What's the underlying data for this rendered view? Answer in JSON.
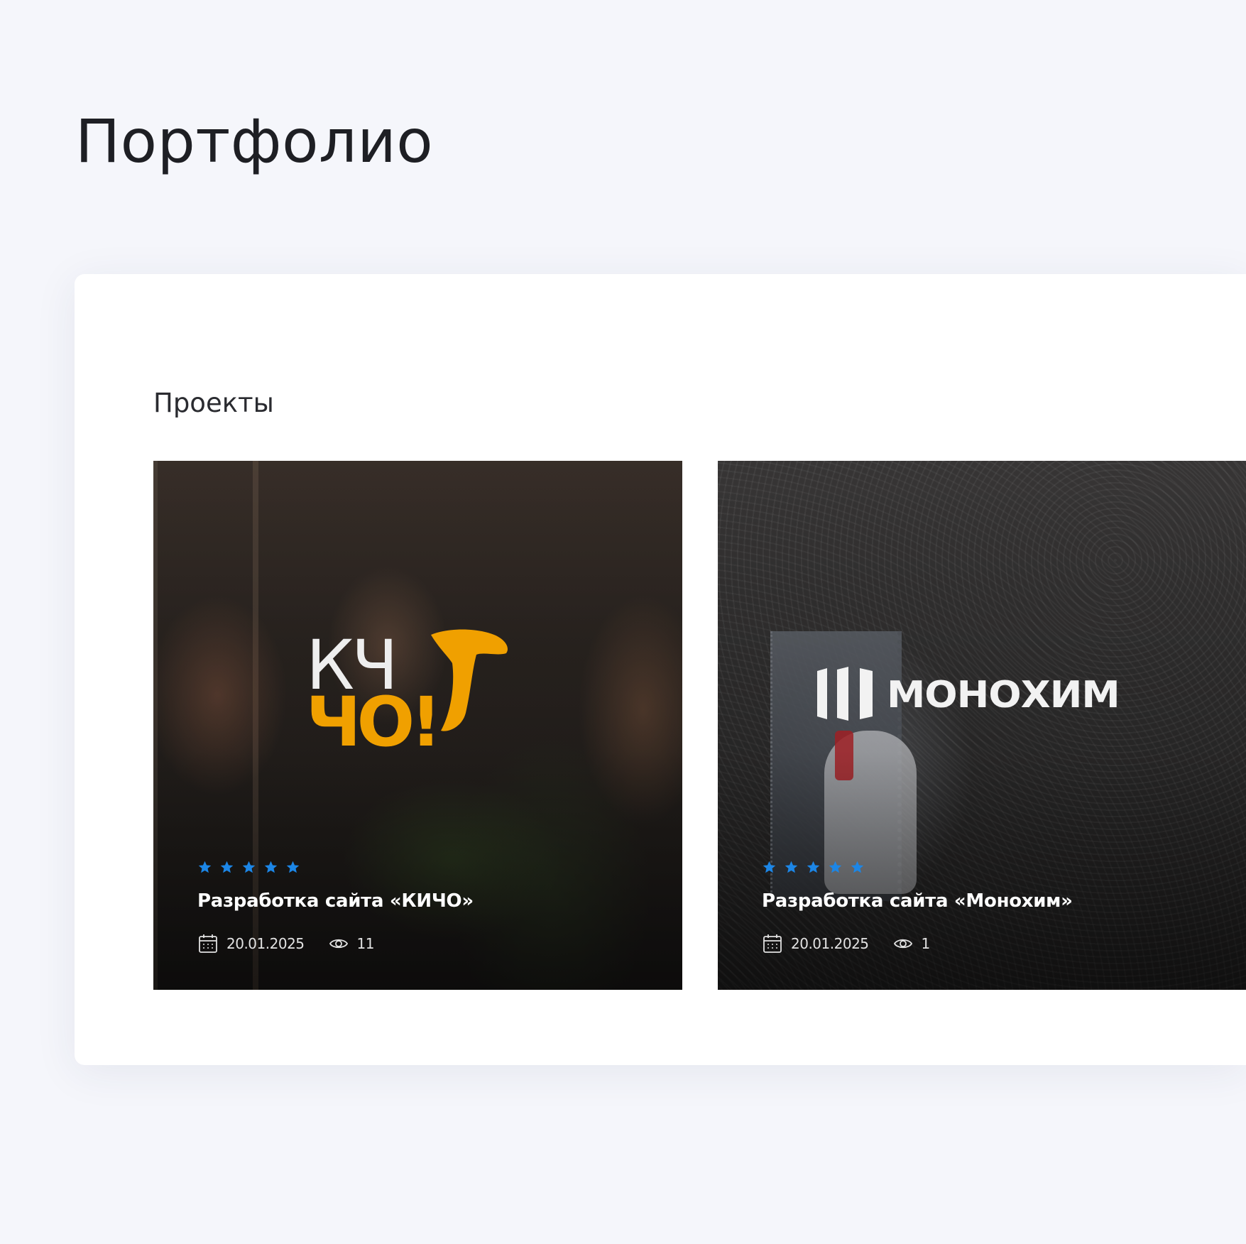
{
  "page": {
    "title": "Портфолио"
  },
  "section": {
    "title": "Проекты"
  },
  "projects": [
    {
      "logo_text_top": "КЧ",
      "logo_text_bottom": "ЧО!",
      "stars": 5,
      "title": "Разработка сайта «КИЧО»",
      "date": "20.01.2025",
      "views": "11"
    },
    {
      "logo_text": "МОНОХИМ",
      "stars": 5,
      "title": "Разработка сайта «Монохим»",
      "date": "20.01.2025",
      "views": "1"
    }
  ],
  "colors": {
    "star": "#1c86e6",
    "background": "#f5f6fb",
    "panel": "#ffffff",
    "kicho_accent": "#f0a000"
  },
  "icons": {
    "date": "calendar-icon",
    "views": "eye-icon",
    "rating": "star-icon"
  }
}
